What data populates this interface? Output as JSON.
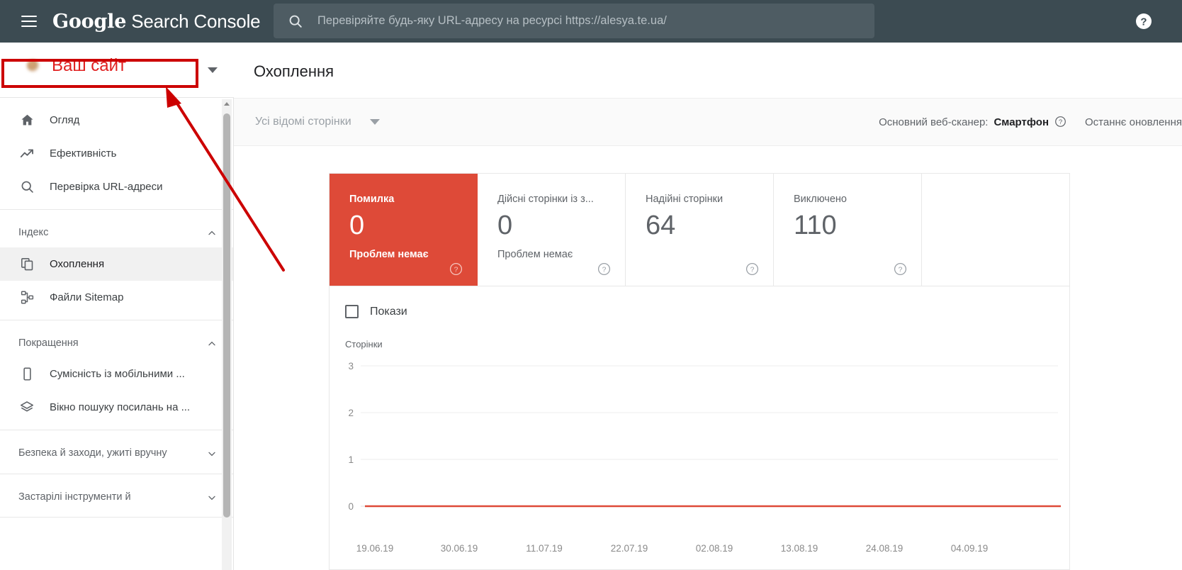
{
  "topbar": {
    "menu_icon": "hamburger-menu-icon",
    "brand_google": "Google",
    "brand_rest": "Search Console",
    "help_icon": "help-circle-icon",
    "search": {
      "icon": "search-icon",
      "placeholder": "Перевіряйте будь-яку URL-адресу на ресурсі https://alesya.te.ua/",
      "value": ""
    }
  },
  "property": {
    "name": "Ваш сайт",
    "favicon": "site-favicon",
    "caret_icon": "chevron-down-icon",
    "annotation_color": "#cc0000",
    "text_color": "#e02020"
  },
  "sidebar": {
    "groups": [
      {
        "type": "items",
        "items": [
          {
            "label": "Огляд",
            "icon": "home-icon",
            "active": false
          },
          {
            "label": "Ефективність",
            "icon": "trending-up-icon",
            "active": false
          },
          {
            "label": "Перевірка URL-адреси",
            "icon": "search-icon",
            "active": false
          }
        ]
      },
      {
        "type": "section",
        "title": "Індекс",
        "chevron": "chevron-up-icon",
        "expanded": true,
        "items": [
          {
            "label": "Охоплення",
            "icon": "copy-pages-icon",
            "active": true
          },
          {
            "label": "Файли Sitemap",
            "icon": "sitemap-icon",
            "active": false
          }
        ]
      },
      {
        "type": "section",
        "title": "Покращення",
        "chevron": "chevron-up-icon",
        "expanded": true,
        "items": [
          {
            "label": "Сумісність із мобільними ...",
            "icon": "mobile-phone-icon",
            "active": false
          },
          {
            "label": "Вікно пошуку посилань на ...",
            "icon": "layers-icon",
            "active": false
          }
        ]
      },
      {
        "type": "section",
        "title": "Безпека й заходи, ужиті вручну",
        "chevron": "chevron-down-icon",
        "expanded": false,
        "items": []
      },
      {
        "type": "section",
        "title": "Застарілі інструменти й",
        "chevron": "chevron-down-icon",
        "expanded": false,
        "items": []
      }
    ]
  },
  "main": {
    "page_title": "Охоплення",
    "filter": {
      "label": "Усі відомі сторінки",
      "caret_icon": "chevron-down-icon"
    },
    "crawler_label": "Основний веб-сканер:",
    "crawler_value": "Смартфон",
    "crawler_help_icon": "help-circle-icon",
    "last_update_label": "Останнє оновлення"
  },
  "cards": [
    {
      "title": "Помилка",
      "value": "0",
      "subtitle": "Проблем немає",
      "state": "error",
      "help_icon": "help-circle-icon",
      "color": "#de4a38"
    },
    {
      "title": "Дійсні сторінки із з...",
      "value": "0",
      "subtitle": "Проблем немає",
      "state": "normal",
      "help_icon": "help-circle-icon"
    },
    {
      "title": "Надійні сторінки",
      "value": "64",
      "subtitle": "",
      "state": "normal",
      "help_icon": "help-circle-icon"
    },
    {
      "title": "Виключено",
      "value": "110",
      "subtitle": "",
      "state": "normal",
      "help_icon": "help-circle-icon"
    },
    {
      "title": "",
      "value": "",
      "subtitle": "",
      "state": "empty",
      "help_icon": ""
    }
  ],
  "legend": {
    "label": "Покази",
    "checked": false
  },
  "chart_data": {
    "type": "line",
    "title": "",
    "ylabel": "Сторінки",
    "xlabel": "",
    "ylim": [
      0,
      3
    ],
    "yticks": [
      3,
      2,
      1,
      0
    ],
    "grid": true,
    "legend_position": "top-left",
    "x_tick_labels": [
      "19.06.19",
      "30.06.19",
      "11.07.19",
      "22.07.19",
      "02.08.19",
      "13.08.19",
      "24.08.19",
      "04.09.19"
    ],
    "series": [
      {
        "name": "Помилка",
        "color": "#de4a38",
        "values": [
          0,
          0,
          0,
          0,
          0,
          0,
          0,
          0
        ]
      }
    ]
  }
}
